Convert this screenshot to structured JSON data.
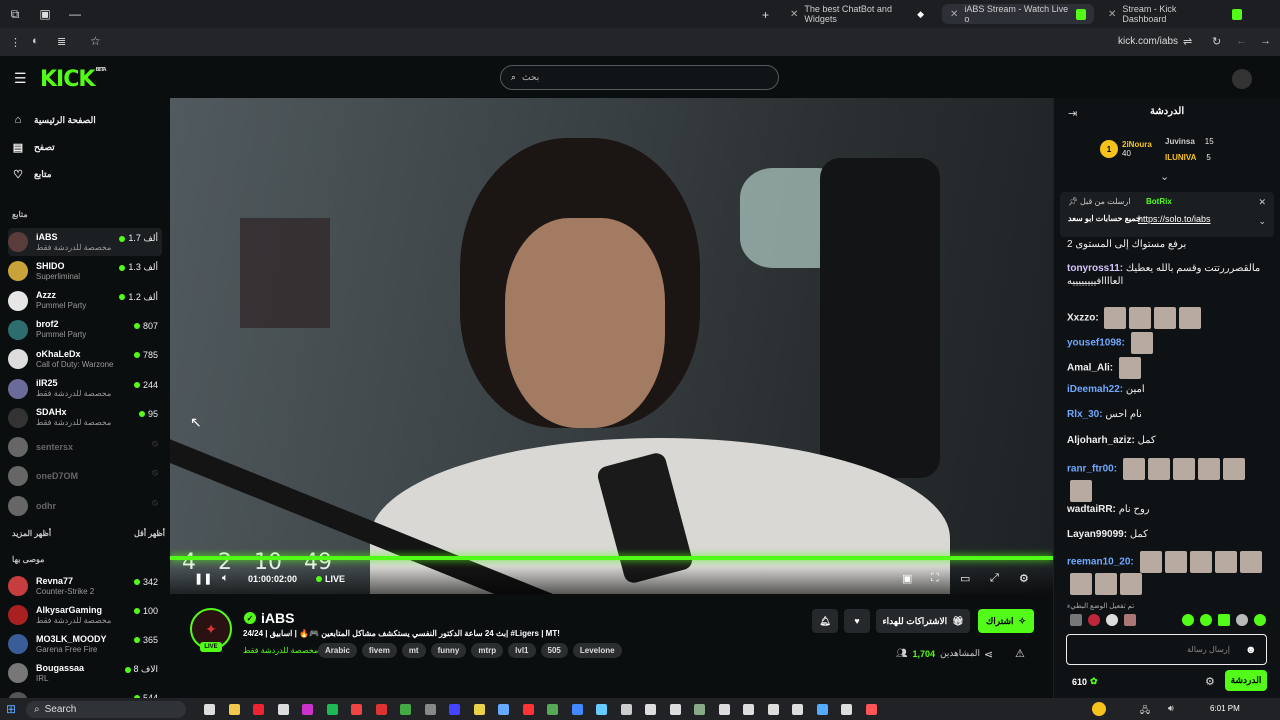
{
  "browser": {
    "tabs": [
      {
        "label": "The best ChatBot and Widgets"
      },
      {
        "label": "iABS Stream - Watch Live o"
      },
      {
        "label": "Stream - Kick Dashboard"
      }
    ],
    "url": "kick.com/iabs"
  },
  "header": {
    "logo": "KICK",
    "logo_tag": "BETA",
    "search_placeholder": "بحث"
  },
  "sidebar": {
    "nav": [
      {
        "label": "الصفحة الرئيسية",
        "icon": "home-icon"
      },
      {
        "label": "تصفح",
        "icon": "browse-icon"
      },
      {
        "label": "متابع",
        "icon": "heart-icon"
      }
    ],
    "following_header": "متابع",
    "following": [
      {
        "name": "iABS",
        "sub": "مخصصة للدردشة فقط",
        "count": "1.7 ألف",
        "online": true
      },
      {
        "name": "SHIDO",
        "sub": "Superliminal",
        "count": "1.3 ألف",
        "online": true
      },
      {
        "name": "Azzz",
        "sub": "Pummel Party",
        "count": "1.2 ألف",
        "online": true
      },
      {
        "name": "brof2",
        "sub": "Pummel Party",
        "count": "807",
        "online": true
      },
      {
        "name": "oKhaLeDx",
        "sub": "Call of Duty: Warzone",
        "count": "785",
        "online": true
      },
      {
        "name": "iIR25",
        "sub": "مخصصة للدردشة فقط",
        "count": "244",
        "online": true
      },
      {
        "name": "SDAHx",
        "sub": "مخصصة للدردشة فقط",
        "count": "95",
        "online": true
      },
      {
        "name": "sentersx",
        "sub": "",
        "count": "",
        "online": false
      },
      {
        "name": "oneD7OM",
        "sub": "",
        "count": "",
        "online": false
      },
      {
        "name": "odhr",
        "sub": "",
        "count": "",
        "online": false
      }
    ],
    "show_more": "أظهر المزيد",
    "show_less": "أظهر أقل",
    "recommended_header": "موصى بها",
    "recommended": [
      {
        "name": "Revna77",
        "sub": "Counter-Strike 2",
        "count": "342"
      },
      {
        "name": "AlkysarGaming",
        "sub": "مخصصة للدردشة فقط",
        "count": "100"
      },
      {
        "name": "MO3LK_MOODY",
        "sub": "Garena Free Fire",
        "count": "365"
      },
      {
        "name": "Bougassaa",
        "sub": "IRL",
        "count": "8 الاف"
      },
      {
        "name": "AbuGhazi",
        "sub": "",
        "count": "544"
      }
    ]
  },
  "player": {
    "timer": [
      "4",
      "2",
      "10",
      "49"
    ],
    "time": "01:00:02:00",
    "live": "LIVE",
    "progress": 1.0
  },
  "stream": {
    "name": "iABS",
    "title": "بث 24 ساعة الدكتور النفسي يستكشف مشاكل المتابعين 🎮🔥 | اسابيق | 24/24| #Ligers | MT!",
    "category": "مخصصة للدردشة فقط",
    "live_badge": "LIVE",
    "tags": [
      "Arabic",
      "fivem",
      "mt",
      "funny",
      "mtrp",
      "lvl1",
      "505",
      "Levelone"
    ],
    "subscribe": "اشتراك",
    "gift_subs": "الاشتراكات للهداء",
    "viewers_label": "المشاهدين",
    "viewers": "1,704"
  },
  "chat": {
    "title": "الدردشة",
    "leaderboard": [
      {
        "name": "2iNoura",
        "count": "40"
      },
      {
        "name": "Juvinsa",
        "count": "15"
      },
      {
        "name": "ILUNIVA",
        "count": "5"
      }
    ],
    "pinned": {
      "by": "BotRix",
      "pinned_label": "ارسلت من قبل",
      "text": "جميع حسابات ابو سعد",
      "link": "https://solo.to/iabs"
    },
    "messages": [
      {
        "user": "",
        "text": "برفع مستواك إلى المستوى 2",
        "color": "#eeeeee"
      },
      {
        "user": "tonyross11:",
        "text": "مالقصرررتتت وقسم بالله يعطيك العاااافييييييييه",
        "color": "#d7c3ff"
      },
      {
        "user": "Xxzzo:",
        "text": "",
        "color": "#eeeeee"
      },
      {
        "user": "yousef1098:",
        "text": "",
        "color": "#6ea8ff"
      },
      {
        "user": "Amal_Ali:",
        "text": "",
        "color": "#eeeeee"
      },
      {
        "user": "iDeemah22:",
        "text": "امين",
        "color": "#6ea8ff"
      },
      {
        "user": "Rlx_30:",
        "text": "نام احس",
        "color": "#6ea8ff"
      },
      {
        "user": "Aljoharh_aziz:",
        "text": "كمل",
        "color": "#eeeeee"
      },
      {
        "user": "ranr_ftr00:",
        "text": "",
        "color": "#6ea8ff"
      },
      {
        "user": "wadtaiRR:",
        "text": "روح نام",
        "color": "#eeeeee"
      },
      {
        "user": "Layan99099:",
        "text": "كمل",
        "color": "#eeeeee"
      },
      {
        "user": "reeman10_20:",
        "text": "",
        "color": "#6ea8ff"
      }
    ],
    "slow_mode": "تم تفعيل الوضع البطيء",
    "input_placeholder": "إرسال رسالة",
    "points": "610",
    "send": "الدردشة"
  },
  "taskbar": {
    "search": "Search",
    "time": "6:01 PM"
  }
}
